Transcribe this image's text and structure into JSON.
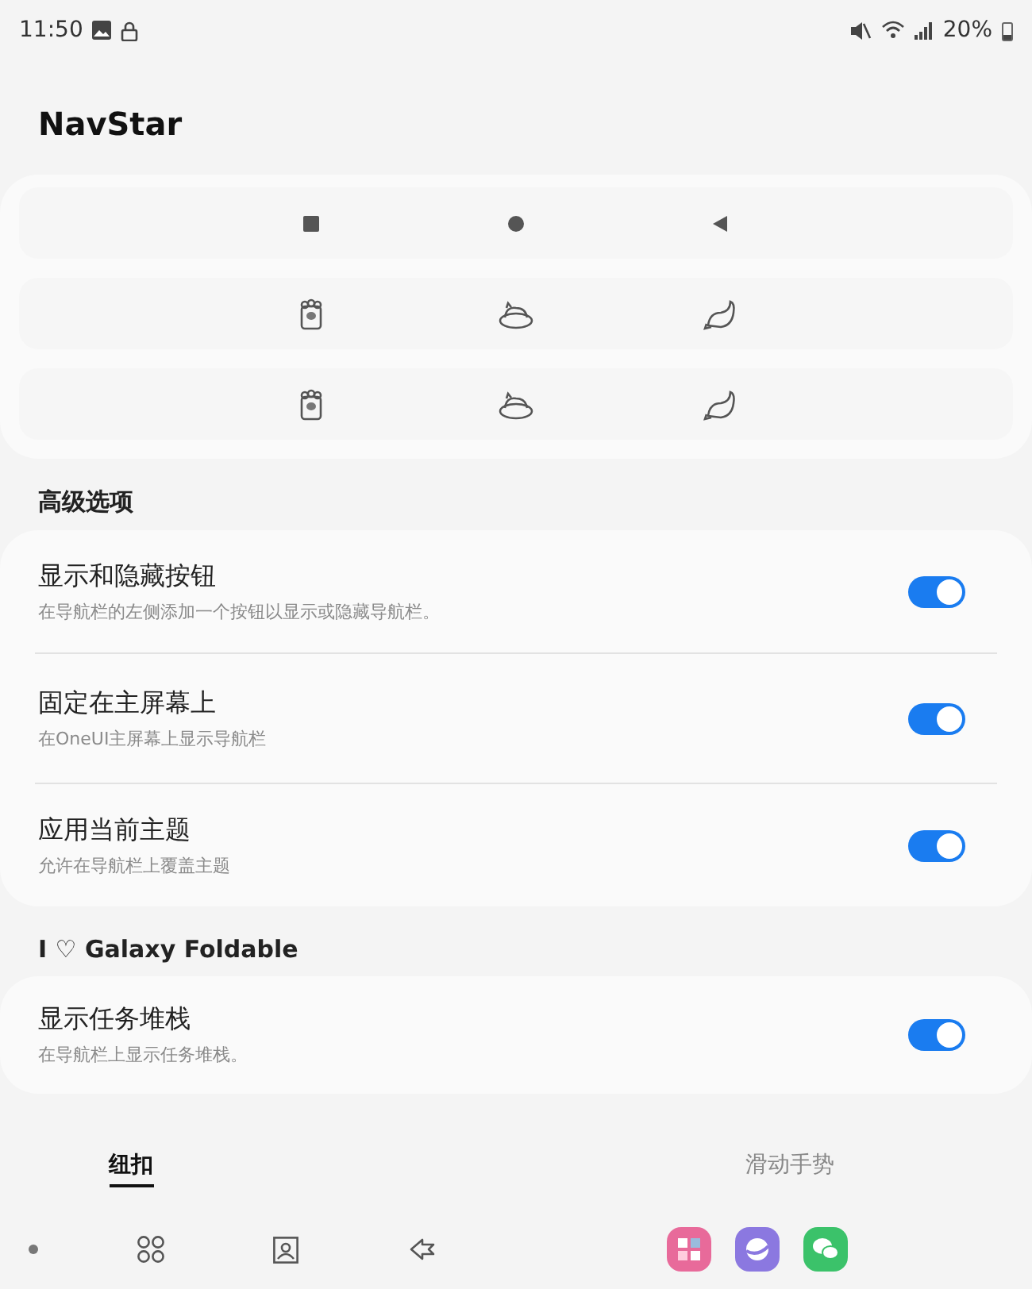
{
  "status_bar": {
    "time": "11:50",
    "battery": "20%"
  },
  "app_title": "NavStar",
  "sections": [
    {
      "title": "高级选项",
      "items": [
        {
          "title": "显示和隐藏按钮",
          "subtitle": "在导航栏的左侧添加一个按钮以显示或隐藏导航栏。",
          "on": true
        },
        {
          "title": "固定在主屏幕上",
          "subtitle": "在OneUI主屏幕上显示导航栏",
          "on": true
        },
        {
          "title": "应用当前主题",
          "subtitle": "允许在导航栏上覆盖主题",
          "on": true
        }
      ]
    },
    {
      "title": "I ♡ Galaxy Foldable",
      "items": [
        {
          "title": "显示任务堆栈",
          "subtitle": "在导航栏上显示任务堆栈。",
          "on": true
        }
      ]
    }
  ],
  "tabs": [
    {
      "label": "纽扣",
      "selected": true
    },
    {
      "label": "滑动手势",
      "selected": false
    }
  ]
}
